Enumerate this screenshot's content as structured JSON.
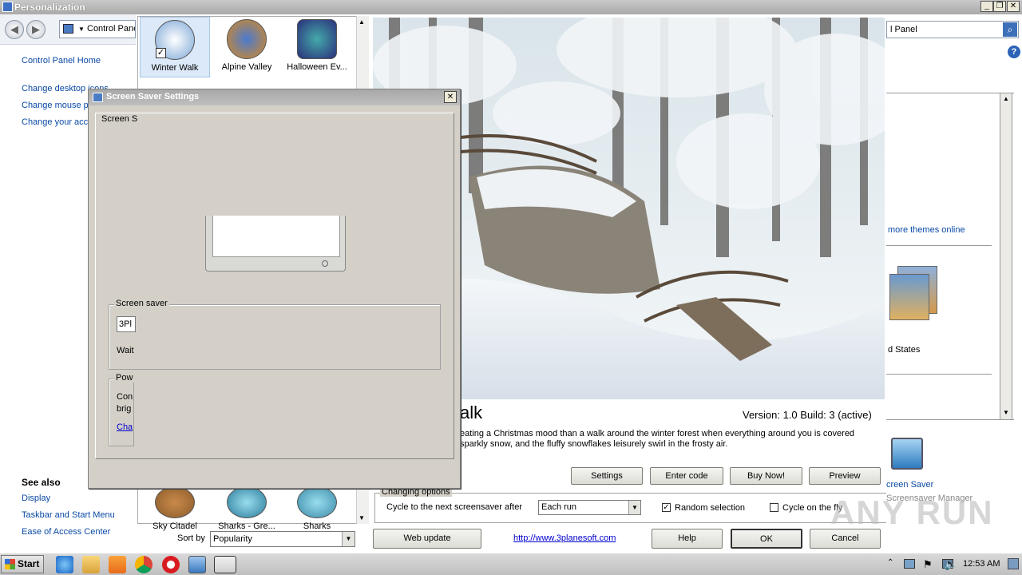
{
  "window": {
    "title": "Personalization",
    "minimize": "_",
    "restore": "❐",
    "close": "✕"
  },
  "address": {
    "breadcrumb": "Control Panel",
    "search_value": "l Panel"
  },
  "left_pane": {
    "home": "Control Panel Home",
    "links": [
      "Change desktop icons",
      "Change mouse pointers",
      "Change your account picture"
    ],
    "see_also_title": "See also",
    "see_also": [
      "Display",
      "Taskbar and Start Menu",
      "Ease of Access Center"
    ]
  },
  "themes": {
    "items": [
      {
        "label": "Winter Walk",
        "color": "#7aa6d6",
        "selected": true
      },
      {
        "label": "Alpine Valley",
        "color": "#d98a1e"
      },
      {
        "label": "Halloween Ev...",
        "color": "#2a2f7a"
      }
    ],
    "bottom_items": [
      {
        "label": "Sky Citadel",
        "color": "#8a5a2a"
      },
      {
        "label": "Sharks - Gre...",
        "color": "#2a7a9a"
      },
      {
        "label": "Sharks",
        "color": "#3a8aa8"
      }
    ],
    "sort_label": "Sort by",
    "sort_value": "Popularity"
  },
  "screensaver": {
    "name_partial": "alk",
    "version": "Version: 1.0 Build: 3 (active)",
    "description": [
      "eating a Christmas mood than a walk around the winter forest when everything around you is covered",
      "sparkly snow, and the fluffy snowflakes leisurely swirl in the frosty air."
    ],
    "buttons": {
      "settings": "Settings",
      "enter_code": "Enter code",
      "buy_now": "Buy Now!",
      "preview": "Preview"
    },
    "changing_options": {
      "legend": "Changing options",
      "cycle_label": "Cycle to the next screensaver after",
      "cycle_value": "Each run",
      "random_label": "Random selection",
      "random_checked": true,
      "cycle_fly_label": "Cycle on the fly",
      "cycle_fly_checked": false
    },
    "footer": {
      "web_update": "Web update",
      "url": "http://www.3planesoft.com",
      "help": "Help",
      "ok": "OK",
      "cancel": "Cancel"
    }
  },
  "right_panel": {
    "more_themes": "more themes online",
    "theme_label": "d States",
    "screen_saver": "creen Saver",
    "screen_saver_sub": "Screensaver Manager"
  },
  "dialog": {
    "title": "Screen Saver Settings",
    "close": "✕",
    "tab": "Screen S",
    "screensaver_group": "Screen saver",
    "screensaver_value": "3Pl",
    "wait_label": "Wait",
    "power_group": "Pow",
    "power_text1": "Con",
    "power_text2": "brig",
    "power_link": "Cha"
  },
  "taskbar": {
    "start": "Start",
    "time": "12:53 AM"
  },
  "watermark": "ANY RUN",
  "colors": {
    "link": "#0a49a6",
    "dialog_bg": "#d4d0c8",
    "taskbar": "#c8c8c8"
  }
}
